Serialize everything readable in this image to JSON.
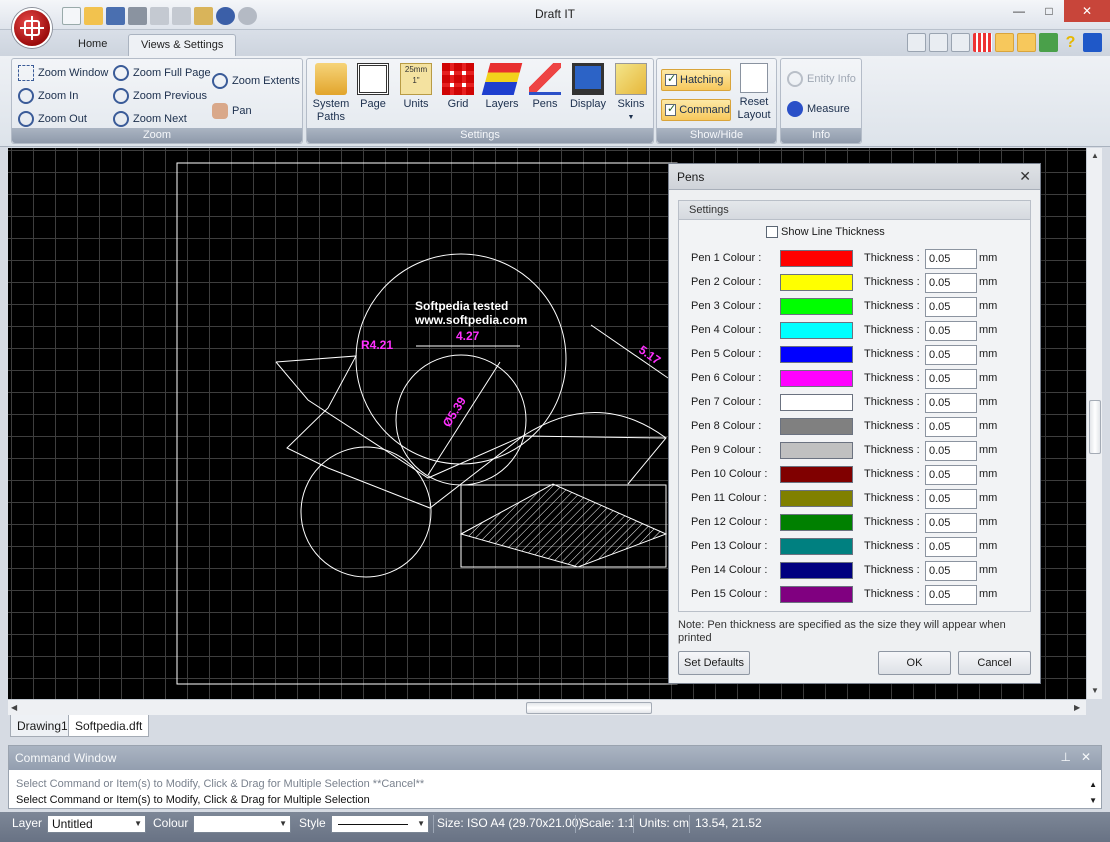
{
  "window": {
    "title": "Draft IT",
    "minimize": "—",
    "maximize": "□",
    "close": "✕"
  },
  "ribbon_tabs": [
    "Home",
    "Views & Settings"
  ],
  "zoom_group": {
    "label": "Zoom",
    "buttons": [
      "Zoom Window",
      "Zoom In",
      "Zoom Out",
      "Zoom Full Page",
      "Zoom Previous",
      "Zoom Next",
      "Zoom Extents",
      "Pan"
    ]
  },
  "settings_group": {
    "label": "Settings",
    "buttons": [
      "System Paths",
      "Page",
      "Units",
      "Grid",
      "Layers",
      "Pens",
      "Display",
      "Skins"
    ],
    "units_icon_top": "25mm",
    "units_icon_bottom": "1\""
  },
  "showhide_group": {
    "label": "Show/Hide",
    "hatching": "Hatching",
    "command": "Command",
    "reset_layout": "Reset Layout"
  },
  "info_group": {
    "label": "Info",
    "entity_info": "Entity Info",
    "measure": "Measure"
  },
  "drawing": {
    "text_line1": "Softpedia  tested",
    "text_line2": "www.softpedia.com",
    "dim_radius": "R4.21",
    "dim_linear": "4.27",
    "dim_diameter": "Ø5.39",
    "dim_angle": "5.17"
  },
  "doc_tabs": [
    "Drawing1",
    "Softpedia.dft"
  ],
  "command_window": {
    "title": "Command Window",
    "line1": "Select Command or Item(s) to Modify, Click & Drag for Multiple Selection  **Cancel**",
    "line2": "Select Command or Item(s) to Modify, Click & Drag for Multiple Selection"
  },
  "statusbar": {
    "layer_label": "Layer",
    "layer_value": "Untitled",
    "colour_label": "Colour",
    "colour_value": "",
    "style_label": "Style",
    "size": "Size: ISO A4 (29.70x21.00)",
    "scale": "Scale: 1:1",
    "units": "Units: cm",
    "coords": "13.54, 21.52"
  },
  "pens_dialog": {
    "title": "Pens",
    "section": "Settings",
    "show_line_thickness": "Show Line Thickness",
    "thickness_label": "Thickness :",
    "unit": "mm",
    "pens": [
      {
        "label": "Pen 1 Colour :",
        "color": "#ff0000",
        "thickness": "0.05"
      },
      {
        "label": "Pen 2 Colour :",
        "color": "#ffff00",
        "thickness": "0.05"
      },
      {
        "label": "Pen 3 Colour :",
        "color": "#00ff00",
        "thickness": "0.05"
      },
      {
        "label": "Pen 4 Colour :",
        "color": "#00ffff",
        "thickness": "0.05"
      },
      {
        "label": "Pen 5 Colour :",
        "color": "#0000ff",
        "thickness": "0.05"
      },
      {
        "label": "Pen 6 Colour :",
        "color": "#ff00ff",
        "thickness": "0.05"
      },
      {
        "label": "Pen 7 Colour :",
        "color": "#ffffff",
        "thickness": "0.05"
      },
      {
        "label": "Pen 8 Colour :",
        "color": "#808080",
        "thickness": "0.05"
      },
      {
        "label": "Pen 9 Colour :",
        "color": "#c0c0c0",
        "thickness": "0.05"
      },
      {
        "label": "Pen 10 Colour :",
        "color": "#800000",
        "thickness": "0.05"
      },
      {
        "label": "Pen 11 Colour :",
        "color": "#808000",
        "thickness": "0.05"
      },
      {
        "label": "Pen 12 Colour :",
        "color": "#008000",
        "thickness": "0.05"
      },
      {
        "label": "Pen 13 Colour :",
        "color": "#008080",
        "thickness": "0.05"
      },
      {
        "label": "Pen 14 Colour :",
        "color": "#000080",
        "thickness": "0.05"
      },
      {
        "label": "Pen 15 Colour :",
        "color": "#800080",
        "thickness": "0.05"
      }
    ],
    "note": "Note: Pen thickness are specified as the size they will appear when printed",
    "set_defaults": "Set Defaults",
    "ok": "OK",
    "cancel": "Cancel"
  }
}
